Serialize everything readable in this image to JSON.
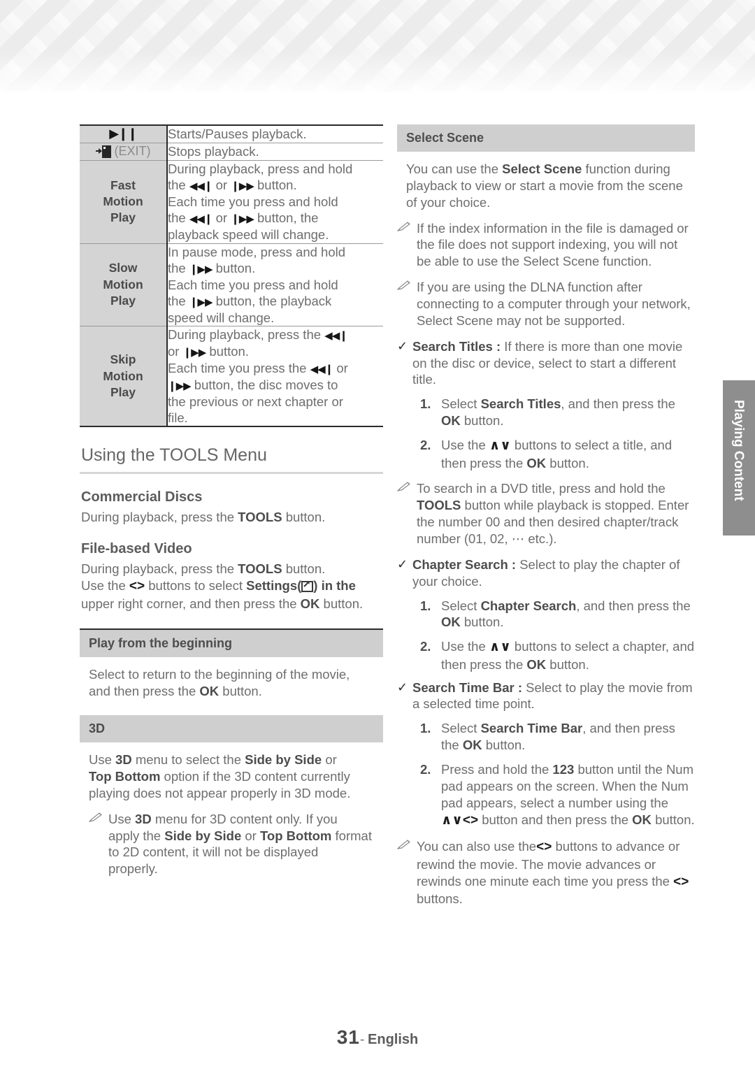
{
  "page": {
    "number": "31",
    "separator": "-",
    "language": "English"
  },
  "side_tab": {
    "label": "Playing Content"
  },
  "button_table": {
    "rows": [
      {
        "key": "",
        "key_icon": "play-pause-icon",
        "value": "Starts/Pauses playback."
      },
      {
        "key": "(EXIT)",
        "key_icon": "exit-icon",
        "value": "Stops playback."
      },
      {
        "key": "Fast\nMotion\nPlay",
        "key_icon": "",
        "value": "During playback, press and hold the ⏮ or ⏭ button.\nEach time you press and hold the ⏮ or ⏭ button, the playback speed will change."
      },
      {
        "key": "Slow\nMotion\nPlay",
        "key_icon": "",
        "value": "In pause mode, press and hold the ⏭ button.\nEach time you press and hold the ⏭ button, the playback speed will change."
      },
      {
        "key": "Skip\nMotion\nPlay",
        "key_icon": "",
        "value": "During playback, press the ⏮ or ⏭ button.\nEach time you press the ⏮ or ⏭ button, the disc moves to the previous or next chapter or file."
      }
    ],
    "key_labels": {
      "fast": [
        "Fast",
        "Motion",
        "Play"
      ],
      "slow": [
        "Slow",
        "Motion",
        "Play"
      ],
      "skip": [
        "Skip",
        "Motion",
        "Play"
      ]
    },
    "exit_label": "(EXIT)",
    "values": {
      "play_pause": "Starts/Pauses playback.",
      "stop": "Stops playback.",
      "fast_l1": "During playback, press and hold",
      "fast_l2a": "the",
      "fast_l2b": "or",
      "fast_l2c": "button.",
      "fast_l3": "Each time you press and hold",
      "fast_l4a": "the",
      "fast_l4b": "or",
      "fast_l4c": "button, the",
      "fast_l5": "playback speed will change.",
      "slow_l1": "In pause mode, press and hold",
      "slow_l2a": "the",
      "slow_l2b": "button.",
      "slow_l3": "Each time you press and hold",
      "slow_l4a": "the",
      "slow_l4b": "button, the playback",
      "slow_l5": "speed will change.",
      "skip_l1": "During playback, press the",
      "skip_l2a": "or",
      "skip_l2b": "button.",
      "skip_l3a": "Each time you press the",
      "skip_l3b": "or",
      "skip_l4": "button, the disc moves to",
      "skip_l5": "the previous or next chapter or",
      "skip_l6": "file."
    }
  },
  "tools_menu": {
    "heading": "Using the TOOLS Menu",
    "commercial": {
      "title": "Commercial Discs",
      "body": "During playback, press the TOOLS button."
    },
    "filebased": {
      "title": "File-based Video",
      "line1": "During playback, press the TOOLS button.",
      "line2a": "Use the",
      "line2b": "buttons to select",
      "line2c": "Settings(",
      "line2d": ") in the",
      "line3": "upper right corner, and then press the OK button."
    },
    "play_beginning": {
      "bar": "Play from the beginning",
      "line1": "Select to return to the beginning of the movie,",
      "line2a": "and then press the",
      "line2b": "OK",
      "line2c": "button."
    },
    "three_d": {
      "bar": "3D",
      "l1a": "Use",
      "l1b": "3D",
      "l1c": "menu to select the",
      "l1d": "Side by Side",
      "l1e": "or",
      "l2a": "Top Bottom",
      "l2b": "option if the 3D content currently",
      "l3": "playing does not appear properly in 3D mode.",
      "note_a": "Use",
      "note_b": "3D",
      "note_c": "menu for 3D content only. If you",
      "note_d": "apply the",
      "note_e": "Side by Side",
      "note_f": "or",
      "note_g": "Top Bottom",
      "note_h": "format",
      "note_i": "to 2D content, it will not be displayed",
      "note_j": "properly."
    }
  },
  "select_scene": {
    "bar": "Select Scene",
    "intro_a": "You can use the",
    "intro_b": "Select Scene",
    "intro_c": "function during",
    "intro_d": "playback to view or start a movie from the scene of your choice.",
    "note1": "If the index information in the file is damaged or the file does not support indexing, you will not be able to use the Select Scene function.",
    "note2": "If you are using the DLNA function after connecting to a computer through your network, Select Scene may not be supported.",
    "search_titles": {
      "label": "Search Titles",
      "colon": ":",
      "desc": "If there is more than one movie on the disc or device, select to start a different title.",
      "steps": [
        {
          "num": "1.",
          "a": "Select",
          "b": "Search Titles",
          "c": ", and then press the",
          "d": "OK",
          "e": "button."
        },
        {
          "num": "2.",
          "a": "Use the",
          "b": "∧∨",
          "c": "buttons to select a title, and then press the",
          "d": "OK",
          "e": "button."
        }
      ],
      "note": "To search in a DVD title, press and hold the TOOLS button while playback is stopped. Enter the number 00 and then desired chapter/track number (01, 02, ⋯ etc.).",
      "note_bold": "TOOLS"
    },
    "chapter_search": {
      "label": "Chapter Search",
      "colon": ":",
      "desc": "Select to play the chapter of your choice.",
      "steps": [
        {
          "num": "1.",
          "a": "Select",
          "b": "Chapter Search",
          "c": ", and then press the",
          "d": "OK",
          "e": "button."
        },
        {
          "num": "2.",
          "a": "Use the",
          "b": "∧∨",
          "c": "buttons to select a chapter, and then press the",
          "d": "OK",
          "e": "button."
        }
      ]
    },
    "search_time_bar": {
      "label": "Search Time Bar",
      "colon": ":",
      "desc": "Select to play the movie from a selected time point.",
      "steps": [
        {
          "num": "1.",
          "a": "Select",
          "b": "Search Time Bar",
          "c": ", and then press the",
          "d": "OK",
          "e": "button."
        },
        {
          "num": "2.",
          "a": "Press and hold the",
          "b": "123",
          "c": "button until the Num pad appears on the screen. When the Num pad appears, select a number using the",
          "d": "∧∨<>",
          "e": "button and then press the",
          "f": "OK",
          "g": "button."
        }
      ],
      "note_a": "You can also use the",
      "note_b": "<>",
      "note_c": "buttons to advance or rewind the movie. The movie advances or rewinds one minute each time you press the",
      "note_d": "<>",
      "note_e": "buttons."
    }
  },
  "icons": {
    "play_pause": "play-pause-icon",
    "prev": "skip-backward-icon",
    "next": "skip-forward-icon",
    "exit": "exit-icon",
    "pencil": "pencil-note-icon",
    "check": "check-bullet-icon",
    "settings": "settings-icon",
    "arrow_left": "arrow-left-icon",
    "arrow_right": "arrow-right-icon",
    "arrow_up": "arrow-up-icon",
    "arrow_down": "arrow-down-icon"
  },
  "colors": {
    "key_cell_bg": "#d4d4d4",
    "bar_bg": "#cfcfcf",
    "side_tab_bg": "#8e8e8e",
    "rule_dark": "#2b2b2b",
    "text": "#6e6e6e"
  }
}
